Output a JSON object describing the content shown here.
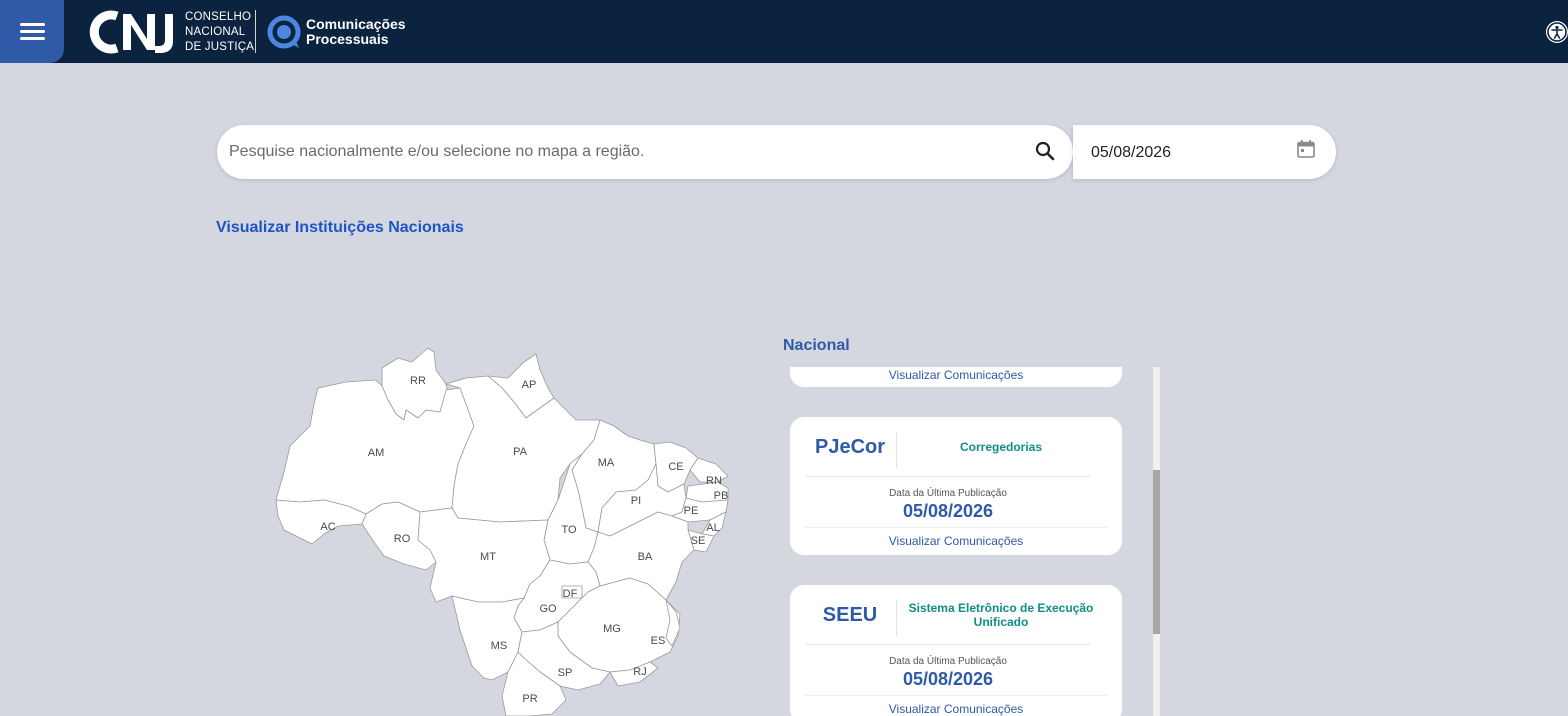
{
  "header": {
    "logo_org_lines": [
      "CONSELHO",
      "NACIONAL",
      "DE JUSTIÇA"
    ],
    "logo_product_lines": [
      "Comunicações",
      "Processuais"
    ]
  },
  "search": {
    "placeholder": "Pesquise nacionalmente e/ou selecione no mapa a região.",
    "value": "",
    "date_value": "05/08/2026"
  },
  "links": {
    "national_institutions": "Visualizar Instituições Nacionais"
  },
  "map": {
    "states": [
      "RR",
      "AP",
      "AM",
      "PA",
      "MA",
      "CE",
      "RN",
      "PB",
      "PI",
      "PE",
      "AL",
      "SE",
      "AC",
      "RO",
      "TO",
      "MT",
      "BA",
      "DF",
      "GO",
      "MG",
      "ES",
      "MS",
      "SP",
      "RJ",
      "PR"
    ]
  },
  "nacional": {
    "title": "Nacional",
    "partial_card_link": "Visualizar Comunicações",
    "cards": [
      {
        "system": "PJeCor",
        "description": "Corregedorias",
        "date_label": "Data da Última Publicação",
        "date": "05/08/2026",
        "link": "Visualizar Comunicações"
      },
      {
        "system": "SEEU",
        "description": "Sistema Eletrônico de Execução Unificado",
        "date_label": "Data da Última Publicação",
        "date": "05/08/2026",
        "link": "Visualizar Comunicações"
      }
    ]
  },
  "colors": {
    "header_bg": "#0c2340",
    "menu_bg": "#2e5aa7",
    "page_bg": "#d4d7df",
    "link_blue": "#1e55c4",
    "accent_blue": "#2e5aa7",
    "teal": "#0e8f80"
  },
  "icons": [
    "menu-icon",
    "cnj-logo",
    "comunicacoes-logo-icon",
    "accessibility-icon",
    "search-icon",
    "calendar-icon"
  ]
}
